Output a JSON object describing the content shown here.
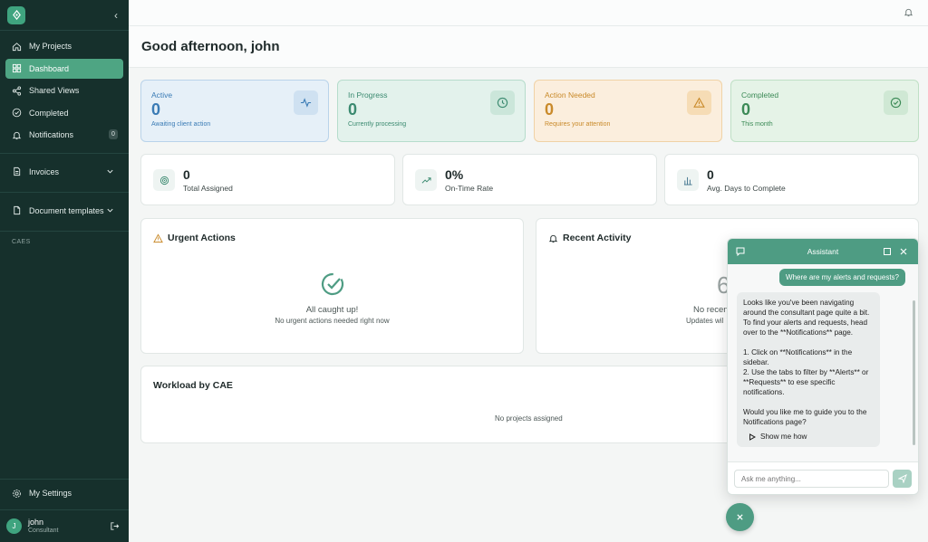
{
  "sidebar": {
    "items": [
      {
        "label": "My Projects",
        "icon": "home-icon"
      },
      {
        "label": "Dashboard",
        "icon": "grid-icon"
      },
      {
        "label": "Shared Views",
        "icon": "share-icon"
      },
      {
        "label": "Completed",
        "icon": "check-circle-icon"
      },
      {
        "label": "Notifications",
        "icon": "bell-icon",
        "badge": "0"
      }
    ],
    "invoices_label": "Invoices",
    "templates_label": "Document templates",
    "cae_label": "CAES",
    "settings_label": "My Settings",
    "user": {
      "initial": "J",
      "name": "john",
      "role": "Consultant"
    }
  },
  "header": {
    "greeting": "Good afternoon, john"
  },
  "status_cards": [
    {
      "label": "Active",
      "value": "0",
      "sub": "Awaiting client action",
      "color": "#3a7bb5"
    },
    {
      "label": "In Progress",
      "value": "0",
      "sub": "Currently processing",
      "color": "#3b8a70"
    },
    {
      "label": "Action Needed",
      "value": "0",
      "sub": "Requires your attention",
      "color": "#c98a2a"
    },
    {
      "label": "Completed",
      "value": "0",
      "sub": "This month",
      "color": "#3b8a56"
    }
  ],
  "metrics": [
    {
      "value": "0",
      "label": "Total Assigned"
    },
    {
      "value": "0%",
      "label": "On-Time Rate"
    },
    {
      "value": "0",
      "label": "Avg. Days to Complete"
    }
  ],
  "urgent": {
    "title": "Urgent Actions",
    "empty_title": "All caught up!",
    "empty_sub": "No urgent actions needed right now"
  },
  "recent": {
    "title": "Recent Activity",
    "empty_title": "No recen",
    "empty_sub": "Updates wil"
  },
  "workload": {
    "title": "Workload by CAE",
    "empty": "No projects assigned"
  },
  "assistant": {
    "title": "Assistant",
    "user_message": "Where are my alerts and requests?",
    "reply": [
      "Looks like you've been navigating around the consultant page quite a bit. To find your alerts and requests, head over to the **Notifications** page.",
      "",
      "1. Click on **Notifications** in the sidebar.",
      "2. Use the tabs to filter by **Alerts** or **Requests** to ese specific notifications.",
      "",
      "Would you like me to guide you to the Notifications page?"
    ],
    "show_me_label": "Show me how",
    "input_placeholder": "Ask me anything..."
  }
}
